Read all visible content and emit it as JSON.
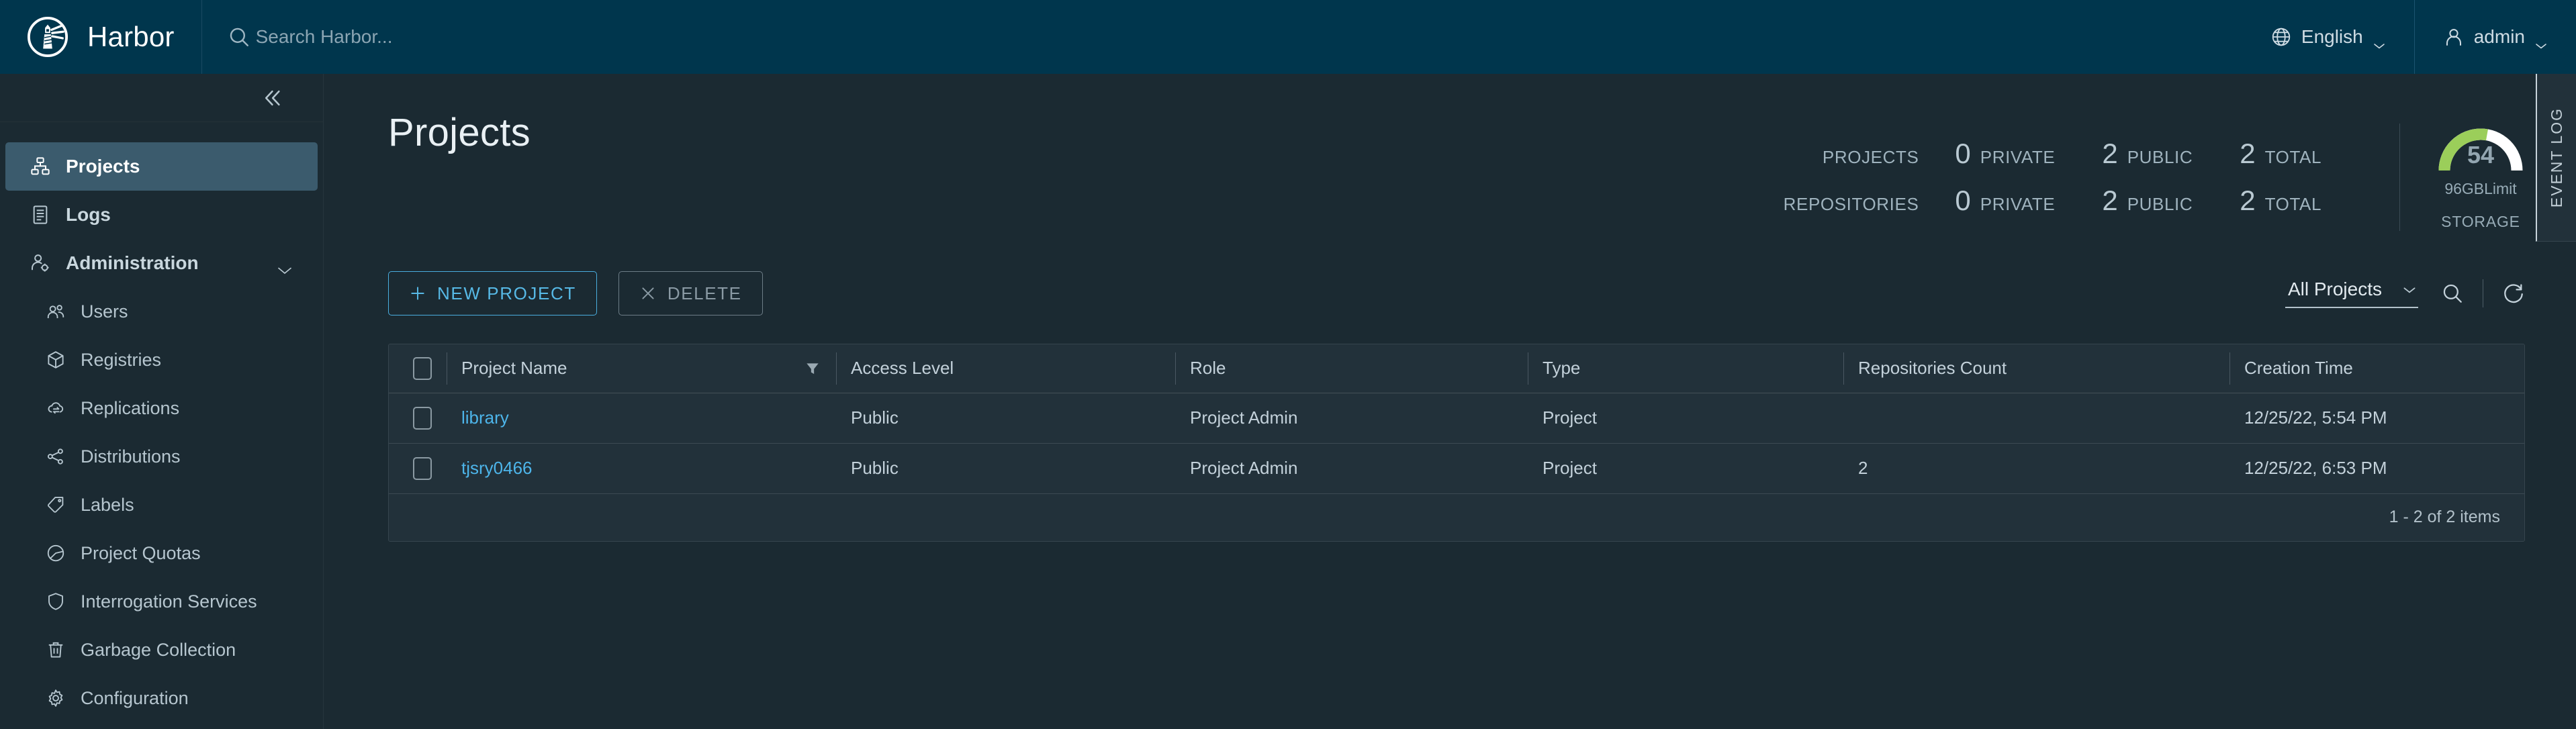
{
  "header": {
    "brand": "Harbor",
    "logo_icon": "harbor-lighthouse-logo",
    "search": {
      "icon": "search-icon",
      "placeholder": "Search Harbor...",
      "value": ""
    },
    "language": {
      "icon": "globe-icon",
      "label": "English",
      "caret": "chevron-down-icon"
    },
    "user": {
      "icon": "user-icon",
      "label": "admin",
      "caret": "chevron-down-icon"
    }
  },
  "sidebar": {
    "collapse_icon": "double-chevron-left-icon",
    "items": [
      {
        "label": "Projects",
        "icon": "projects-icon",
        "level": "top",
        "active": true,
        "bold": true
      },
      {
        "label": "Logs",
        "icon": "logs-icon",
        "level": "top",
        "active": false,
        "bold": true
      },
      {
        "label": "Administration",
        "icon": "admin-user-gear-icon",
        "level": "top",
        "active": false,
        "bold": true,
        "expander": "chevron-down-icon"
      },
      {
        "label": "Users",
        "icon": "users-icon",
        "level": "sub",
        "active": false,
        "bold": false
      },
      {
        "label": "Registries",
        "icon": "cube-icon",
        "level": "sub",
        "active": false,
        "bold": false
      },
      {
        "label": "Replications",
        "icon": "cloud-sync-icon",
        "level": "sub",
        "active": false,
        "bold": false
      },
      {
        "label": "Distributions",
        "icon": "share-nodes-icon",
        "level": "sub",
        "active": false,
        "bold": false
      },
      {
        "label": "Labels",
        "icon": "tag-icon",
        "level": "sub",
        "active": false,
        "bold": false
      },
      {
        "label": "Project Quotas",
        "icon": "pie-chart-icon",
        "level": "sub",
        "active": false,
        "bold": false
      },
      {
        "label": "Interrogation Services",
        "icon": "shield-icon",
        "level": "sub",
        "active": false,
        "bold": false
      },
      {
        "label": "Garbage Collection",
        "icon": "trash-icon",
        "level": "sub",
        "active": false,
        "bold": false
      },
      {
        "label": "Configuration",
        "icon": "gear-icon",
        "level": "sub",
        "active": false,
        "bold": false
      }
    ]
  },
  "page": {
    "title": "Projects",
    "statistics": {
      "rows": [
        {
          "label": "PROJECTS",
          "cells": [
            {
              "value": "0",
              "unit": "PRIVATE"
            },
            {
              "value": "2",
              "unit": "PUBLIC"
            },
            {
              "value": "2",
              "unit": "TOTAL"
            }
          ]
        },
        {
          "label": "REPOSITORIES",
          "cells": [
            {
              "value": "0",
              "unit": "PRIVATE"
            },
            {
              "value": "2",
              "unit": "PUBLIC"
            },
            {
              "value": "2",
              "unit": "TOTAL"
            }
          ]
        }
      ]
    },
    "storage": {
      "value": "54",
      "limit": "96GBLimit",
      "caption": "STORAGE",
      "percent": 55,
      "arc_color": "#9bce5a",
      "track_color": "#ffffff"
    }
  },
  "toolbar": {
    "new_project_label": "NEW PROJECT",
    "new_project_icon": "plus-icon",
    "delete_label": "DELETE",
    "delete_icon": "close-x-icon",
    "filter_selected": "All Projects",
    "filter_caret": "chevron-down-icon",
    "search_icon": "search-icon",
    "refresh_icon": "refresh-icon"
  },
  "table": {
    "columns": [
      {
        "key": "check",
        "label": ""
      },
      {
        "key": "name",
        "label": "Project Name",
        "filter_icon": "filter-icon"
      },
      {
        "key": "access",
        "label": "Access Level"
      },
      {
        "key": "role",
        "label": "Role"
      },
      {
        "key": "type",
        "label": "Type"
      },
      {
        "key": "repos",
        "label": "Repositories Count"
      },
      {
        "key": "time",
        "label": "Creation Time"
      }
    ],
    "rows": [
      {
        "name": "library",
        "access": "Public",
        "role": "Project Admin",
        "type": "Project",
        "repos": "",
        "time": "12/25/22, 5:54 PM"
      },
      {
        "name": "tjsry0466",
        "access": "Public",
        "role": "Project Admin",
        "type": "Project",
        "repos": "2",
        "time": "12/25/22, 6:53 PM"
      }
    ],
    "footer": "1 - 2 of 2 items"
  },
  "event_log": {
    "label": "EVENT LOG"
  },
  "colors": {
    "header_bg": "#00364d",
    "app_bg": "#1b2a32",
    "card_bg": "#22313a",
    "accent_link": "#4db5ea",
    "accent_button": "#57b9e6",
    "gauge_green": "#9bce5a"
  }
}
